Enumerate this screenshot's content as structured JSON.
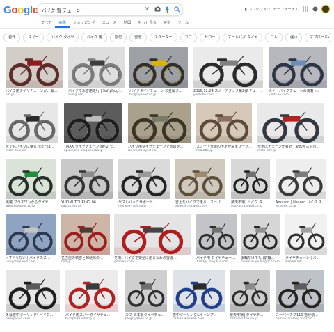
{
  "header": {
    "logo_letters": [
      {
        "ch": "G",
        "color": "#4285f4"
      },
      {
        "ch": "o",
        "color": "#ea4335"
      },
      {
        "ch": "o",
        "color": "#fbbc05"
      },
      {
        "ch": "g",
        "color": "#4285f4"
      },
      {
        "ch": "l",
        "color": "#34a853"
      },
      {
        "ch": "e",
        "color": "#ea4335"
      }
    ],
    "search_query": "バイク 雪 チェーン",
    "collection_label": "コレクション",
    "safesearch_label": "セーフサーチ・",
    "icons": [
      "close-icon",
      "camera-icon",
      "mic-icon",
      "search-icon",
      "apps-icon",
      "notifications-icon"
    ]
  },
  "tabs": [
    "すべて",
    "画像",
    "ショッピング",
    "ニュース",
    "地図",
    "もっと見る",
    "設定",
    "ツール"
  ],
  "active_tab": "画像",
  "chips": [
    "自作",
    "スノー",
    "バイク タイヤ",
    "バイク 用",
    "原付",
    "雪道",
    "スクーター",
    "カブ",
    "セロー",
    "オートバイ タイヤ",
    "ゴム",
    "強い",
    "オフロード",
    "雪 の 日",
    "代用"
  ],
  "results": [
    {
      "caption": "バイク用タイヤチェーンが、風...",
      "source": "nifl.jp",
      "colors": [
        "#d2cdc6",
        "#5a2c2a",
        "#8c1b1b"
      ]
    },
    {
      "caption": "バイクで氷雪路走行 | SafiyDog...",
      "source": "s-dog.net",
      "colors": [
        "#dedede",
        "#7d7d7d",
        "#3e3e3e"
      ]
    },
    {
      "caption": "バイクタイヤチェーン 非金属タ...",
      "source": "blogs.yahoo.co.jp",
      "colors": [
        "#9da0a5",
        "#2f2f2f",
        "#e0b000"
      ]
    },
    {
      "caption": "2016.12.24 スノーアタック第2弾 チェー...",
      "source": "youtube.com",
      "colors": [
        "#eaeaea",
        "#2a2a2a",
        "#7f7f7f"
      ]
    },
    {
      "caption": "スノーバイクチェーンの装着 -...",
      "source": "youtube.com",
      "colors": [
        "#b7b8bd",
        "#2e3540",
        "#6b8fb8"
      ]
    },
    {
      "caption": "雪でもバイクに乗る方法とは...",
      "source": "moto-be.com",
      "colors": [
        "#e7e7e7",
        "#6a6a6a",
        "#2a2a2a"
      ]
    },
    {
      "caption": "TMAX タイヤチェーン sw-2 モ...",
      "source": "apiomario-blog.seesaa.jp",
      "colors": [
        "#5c5c5c",
        "#1d1d1d",
        "#bdbdbd"
      ]
    },
    {
      "caption": "バイク用タイヤチェーンで雪の走...",
      "source": "lovemotorcycle.net",
      "colors": [
        "#a9a18c",
        "#3b3324",
        "#7a7a6a"
      ]
    },
    {
      "caption": "スノー・雪道の予定が決まりーツーリン...",
      "source": "miatabe.jp",
      "colors": [
        "#d7c9b9",
        "#5b4a3a",
        "#8a7060"
      ]
    },
    {
      "caption": "雪道はチェーンが有効 | 愛知県三好市...",
      "source": "moto-adv.jp",
      "colors": [
        "#e9e9e9",
        "#2c3a44",
        "#b52222"
      ]
    },
    {
      "caption": "風魔 ブラスワンからタイヤ...",
      "source": "www.bikebros.co.jp",
      "colors": [
        "#d9e3d8",
        "#2b2b2b",
        "#1f8f3a"
      ]
    },
    {
      "caption": "YUKIMI TOURING 06",
      "source": "gascotties.jp",
      "colors": [
        "#c9c9c9",
        "#333333",
        "#8b8b8b"
      ]
    },
    {
      "caption": "ヤスルバックサポート",
      "source": "monkey-fibre.com",
      "colors": [
        "#dadada",
        "#222222",
        "#9a9a9a"
      ]
    },
    {
      "caption": "雪上をバイクで走る…スーパー...",
      "source": "ae9638.9.2web.com",
      "colors": [
        "#cfc9bf",
        "#5c4e3a",
        "#9c8a6a"
      ]
    },
    {
      "caption": "楽天市場] バイク タ...",
      "source": "search.rakuten.co.jp",
      "colors": [
        "#d8d8d8",
        "#1f1f1f",
        "#6f6f6f"
      ]
    },
    {
      "caption": "Amazon | Nassed バイク ス...",
      "source": "amazon.co.jp",
      "colors": [
        "#eeeeee",
        "#3a3a3a",
        "#7a7a7a"
      ]
    },
    {
      "caption": "☆すべらない | バイクのス...",
      "source": "noriyoromania.com",
      "colors": [
        "#8fa3c2",
        "#2a3850",
        "#c4c4c4"
      ]
    },
    {
      "caption": "名古屋の積雪と郵便局の...",
      "source": "niifi.jp",
      "colors": [
        "#cdb6a8",
        "#a01c1c",
        "#4a3a30"
      ]
    },
    {
      "caption": "冬場、バイクで安全に走るための雪道...",
      "source": "goobike.com",
      "colors": [
        "#e4e4e4",
        "#b41c1c",
        "#444444"
      ]
    },
    {
      "caption": "バイク用 タイヤチェーン・...",
      "source": "1200gs.blog.fc2.com",
      "colors": [
        "#c2c4c7",
        "#2d2d2d",
        "#707070"
      ]
    },
    {
      "caption": "後輪だけでも (前輪...",
      "source": "bikedaisuyo.blog.fc2.com",
      "colors": [
        "#d6d6d6",
        "#262626",
        "#8f8f8f"
      ]
    },
    {
      "caption": "タイヤチェーン | バ...",
      "source": "webike.net",
      "colors": [
        "#f1f1f1",
        "#2f2f2f",
        "#9f9f9f"
      ]
    },
    {
      "caption": "冬は雪中ツーリング! バイク...",
      "source": "bikeryouko.com",
      "colors": [
        "#e6e6e6",
        "#1e1e1e",
        "#5a5a5a"
      ]
    },
    {
      "caption": "バイク用スノーダイヤチェ...",
      "source": "funaplus1.exblog.jp",
      "colors": [
        "#ebebeb",
        "#b62020",
        "#3a3a3a"
      ]
    },
    {
      "caption": "カブ 日本製タイヤチェーン",
      "source": "blogs.yahoo.co.jp",
      "colors": [
        "#cfcfcf",
        "#2c2c2c",
        "#6e6e6e"
      ]
    },
    {
      "caption": "雪中ツーリング&キャンプ...",
      "source": "park20.wakwak.com",
      "colors": [
        "#dfe3e8",
        "#1f3f8f",
        "#2b2b2b"
      ]
    },
    {
      "caption": "楽天市場] タイヤチ...",
      "source": "item.rakuten.co.jp",
      "colors": [
        "#cccccc",
        "#2a2a2a",
        "#8a8a8a"
      ]
    },
    {
      "caption": "スーパーカブ110 雪が積...",
      "source": "hamuusan.blog.fc2.com",
      "colors": [
        "#bfc2c6",
        "#232323",
        "#5c5c5c"
      ]
    }
  ]
}
